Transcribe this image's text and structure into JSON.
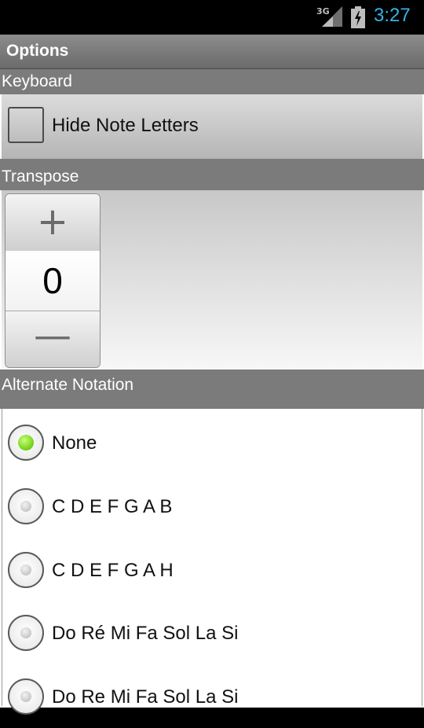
{
  "status_bar": {
    "network_label": "3G",
    "time": "3:27",
    "signal_icon": "signal-icon",
    "battery_icon": "battery-charging-icon",
    "clock_color": "#33b5e5"
  },
  "title_bar": {
    "title": "Options"
  },
  "sections": {
    "keyboard": {
      "header": "Keyboard",
      "hide_note_letters": {
        "label": "Hide Note Letters",
        "checked": false
      }
    },
    "transpose": {
      "header": "Transpose",
      "increment_symbol": "+",
      "value": "0",
      "decrement_symbol": "—"
    },
    "alternate_notation": {
      "header": "Alternate Notation",
      "options": [
        {
          "label": "None",
          "selected": true
        },
        {
          "label": "C D E F G A B",
          "selected": false
        },
        {
          "label": "C D E F G A H",
          "selected": false
        },
        {
          "label": "Do Ré Mi Fa Sol La Si",
          "selected": false
        },
        {
          "label": "Do Re Mi Fa Sol La Si",
          "selected": false
        }
      ],
      "selected_color": "#7ad31f"
    }
  }
}
